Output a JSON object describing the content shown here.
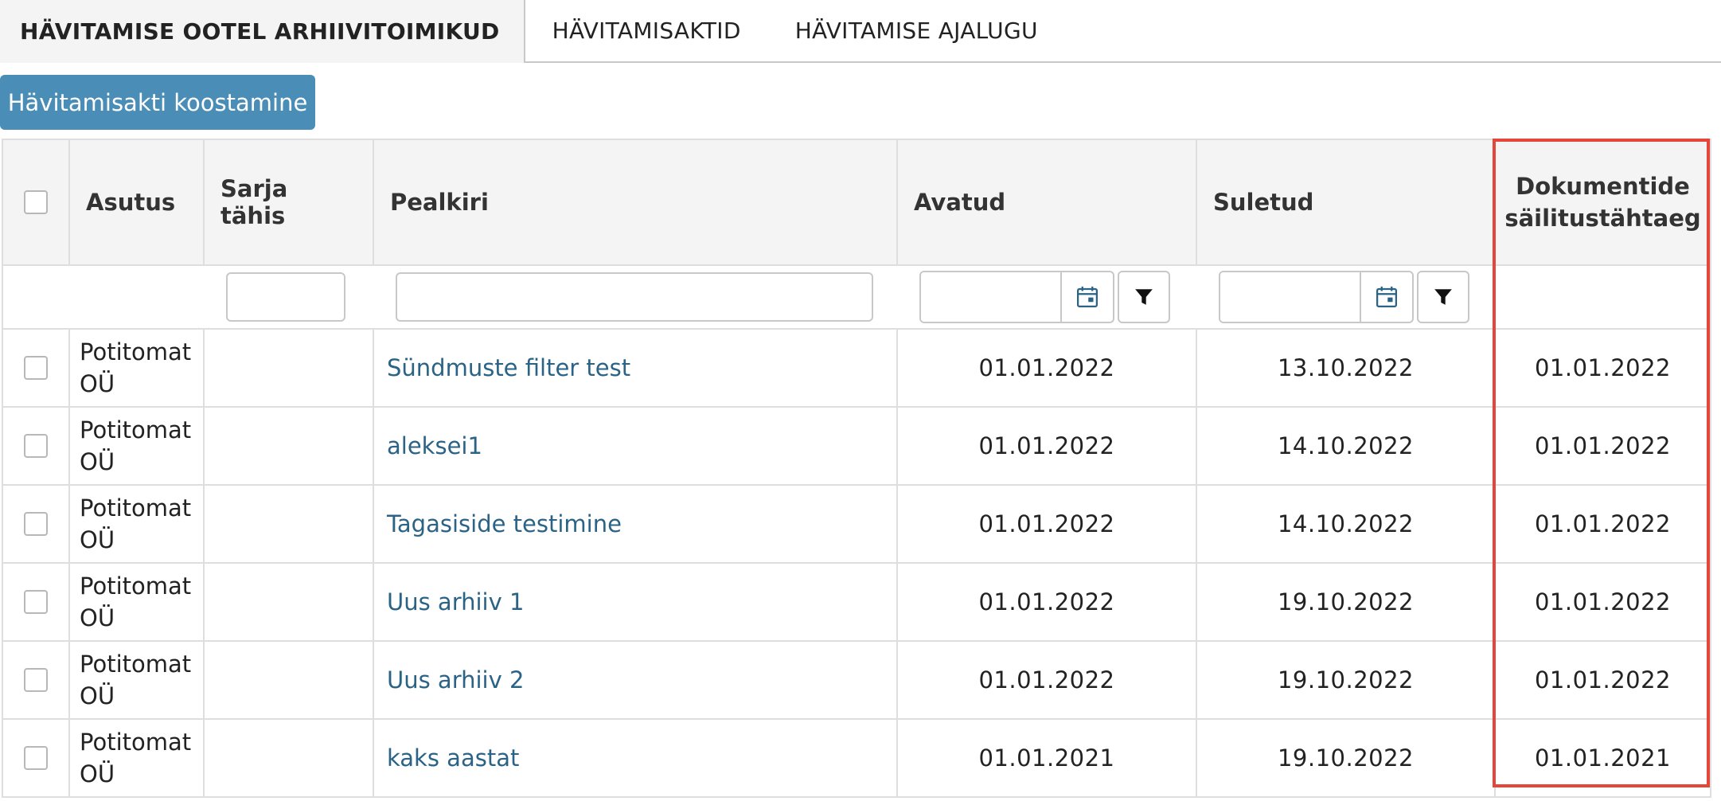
{
  "tabs": [
    {
      "label": "HÄVITAMISE OOTEL ARHIIVITOIMIKUD",
      "active": true
    },
    {
      "label": "HÄVITAMISAKTID",
      "active": false
    },
    {
      "label": "HÄVITAMISE AJALUGU",
      "active": false
    }
  ],
  "toolbar": {
    "compose_label": "Hävitamisakti koostamine"
  },
  "table": {
    "headers": {
      "asutus": "Asutus",
      "sarja_tahis": "Sarja tähis",
      "pealkiri": "Pealkiri",
      "avatud": "Avatud",
      "suletud": "Suletud",
      "sailitus_line1": "Dokumentide",
      "sailitus_line2": "säilitustähtaeg"
    },
    "rows": [
      {
        "org_line1": "Potitomat",
        "org_line2": "OÜ",
        "series": "",
        "title": "Sündmuste filter test",
        "opened": "01.01.2022",
        "closed": "13.10.2022",
        "retention": "01.01.2022"
      },
      {
        "org_line1": "Potitomat",
        "org_line2": "OÜ",
        "series": "",
        "title": "aleksei1",
        "opened": "01.01.2022",
        "closed": "14.10.2022",
        "retention": "01.01.2022"
      },
      {
        "org_line1": "Potitomat",
        "org_line2": "OÜ",
        "series": "",
        "title": "Tagasiside testimine",
        "opened": "01.01.2022",
        "closed": "14.10.2022",
        "retention": "01.01.2022"
      },
      {
        "org_line1": "Potitomat",
        "org_line2": "OÜ",
        "series": "",
        "title": "Uus arhiiv 1",
        "opened": "01.01.2022",
        "closed": "19.10.2022",
        "retention": "01.01.2022"
      },
      {
        "org_line1": "Potitomat",
        "org_line2": "OÜ",
        "series": "",
        "title": "Uus arhiiv 2",
        "opened": "01.01.2022",
        "closed": "19.10.2022",
        "retention": "01.01.2022"
      },
      {
        "org_line1": "Potitomat",
        "org_line2": "OÜ",
        "series": "",
        "title": "kaks aastat",
        "opened": "01.01.2021",
        "closed": "19.10.2022",
        "retention": "01.01.2021"
      }
    ]
  },
  "icons": {
    "calendar": "calendar-icon",
    "filter": "filter-icon"
  },
  "colors": {
    "accent_button": "#4a8db6",
    "link": "#2a6386",
    "highlight": "#e4473a"
  }
}
